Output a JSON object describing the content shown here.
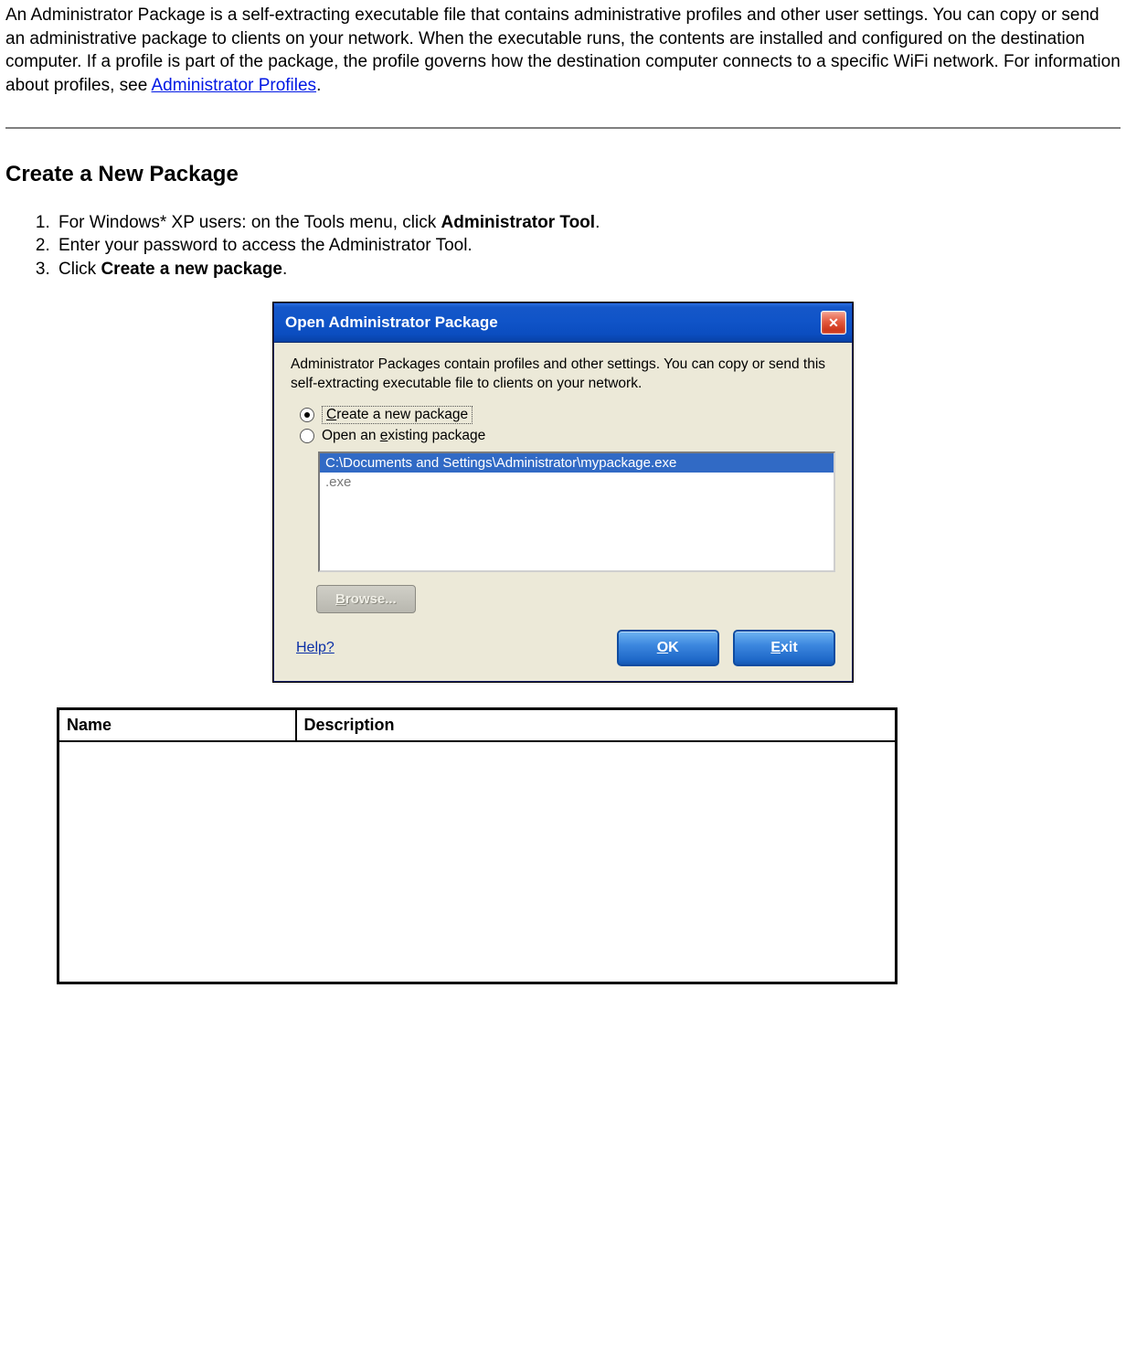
{
  "intro": {
    "text_before_link": "An Administrator Package is a self-extracting executable file that contains administrative profiles and other user settings. You can copy or send an administrative package to clients on your network. When the executable runs, the contents are installed and configured on the destination computer. If a profile is part of the package, the profile governs how the destination computer connects to a specific WiFi network. For information about profiles, see ",
    "link_text": "Administrator Profiles",
    "text_after_link": "."
  },
  "section_heading": "Create a New Package",
  "steps": {
    "s1_prefix": "For Windows* XP users: on the Tools menu, click ",
    "s1_bold": "Administrator Tool",
    "s1_suffix": ".",
    "s2": "Enter your password to access the Administrator Tool.",
    "s3_prefix": "Click ",
    "s3_bold": "Create a new package",
    "s3_suffix": "."
  },
  "dialog": {
    "title": "Open Administrator Package",
    "close_glyph": "✕",
    "description": "Administrator Packages contain profiles and other settings. You can copy or send this self-extracting executable file to clients on your network.",
    "radio1_pre": "",
    "radio1_u": "C",
    "radio1_post": "reate a new package",
    "radio2_pre": "Open an ",
    "radio2_u": "e",
    "radio2_post": "xisting package",
    "list_item_selected": "C:\\Documents and Settings\\Administrator\\mypackage.exe",
    "list_item_2": ".exe",
    "browse_u": "B",
    "browse_post": "rowse...",
    "help_text": "Help?",
    "ok_u": "O",
    "ok_post": "K",
    "exit_u": "E",
    "exit_post": "xit"
  },
  "table": {
    "col1": "Name",
    "col2": "Description"
  }
}
